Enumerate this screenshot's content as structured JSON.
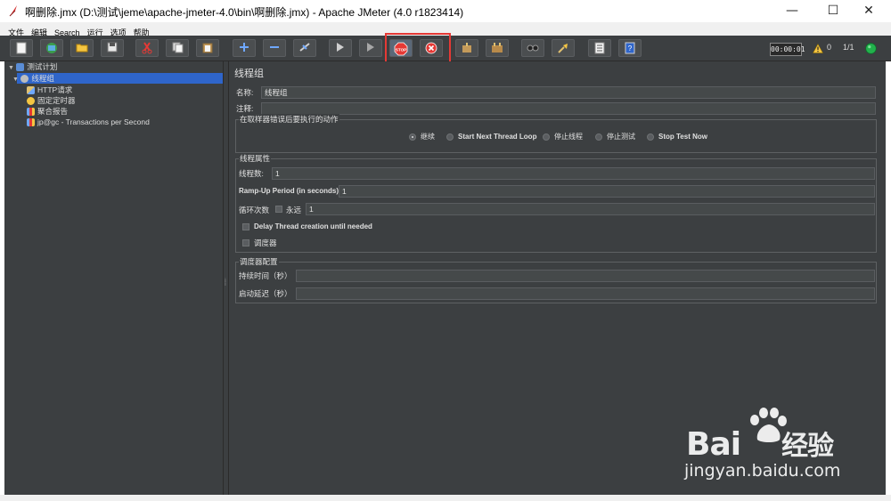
{
  "window": {
    "title": "啊删除.jmx (D:\\测试\\jeme\\apache-jmeter-4.0\\bin\\啊删除.jmx) - Apache JMeter (4.0 r1823414)",
    "minimize": "—",
    "maximize": "☐",
    "close": "✕"
  },
  "menu": [
    "文件",
    "编辑",
    "Search",
    "运行",
    "选项",
    "帮助"
  ],
  "toolbar": {
    "stop_label": "STOP",
    "timer": "00:00:01",
    "warning_count": "0",
    "thread_ratio": "1/1",
    "status_color": "#22b14c",
    "highlight_color": "#e53935"
  },
  "tree": {
    "root": "测试计划",
    "thread_group": "线程组",
    "children": [
      "HTTP请求",
      "固定定时器",
      "聚合报告",
      "jp@gc - Transactions per Second"
    ]
  },
  "main": {
    "title": "线程组",
    "name_label": "名称:",
    "name_value": "线程组",
    "comment_label": "注释:",
    "comment_value": "",
    "error_group_label": "在取样器错误后要执行的动作",
    "error_actions": [
      "继续",
      "Start Next Thread Loop",
      "停止线程",
      "停止测试",
      "Stop Test Now"
    ],
    "error_selected": "继续",
    "thread_props_label": "线程属性",
    "threads_label": "线程数:",
    "threads_value": "1",
    "rampup_label": "Ramp-Up Period (in seconds):",
    "rampup_value": "1",
    "loop_label": "循环次数",
    "forever_label": "永远",
    "loop_value": "1",
    "delay_label": "Delay Thread creation until needed",
    "scheduler_label": "调度器",
    "scheduler_config_label": "调度器配置",
    "duration_label": "持续时间（秒）",
    "duration_value": "",
    "startup_label": "启动延迟（秒）",
    "startup_value": ""
  },
  "watermark": {
    "brand": "Bai",
    "brand2": "经验",
    "url": "jingyan.baidu.com"
  }
}
